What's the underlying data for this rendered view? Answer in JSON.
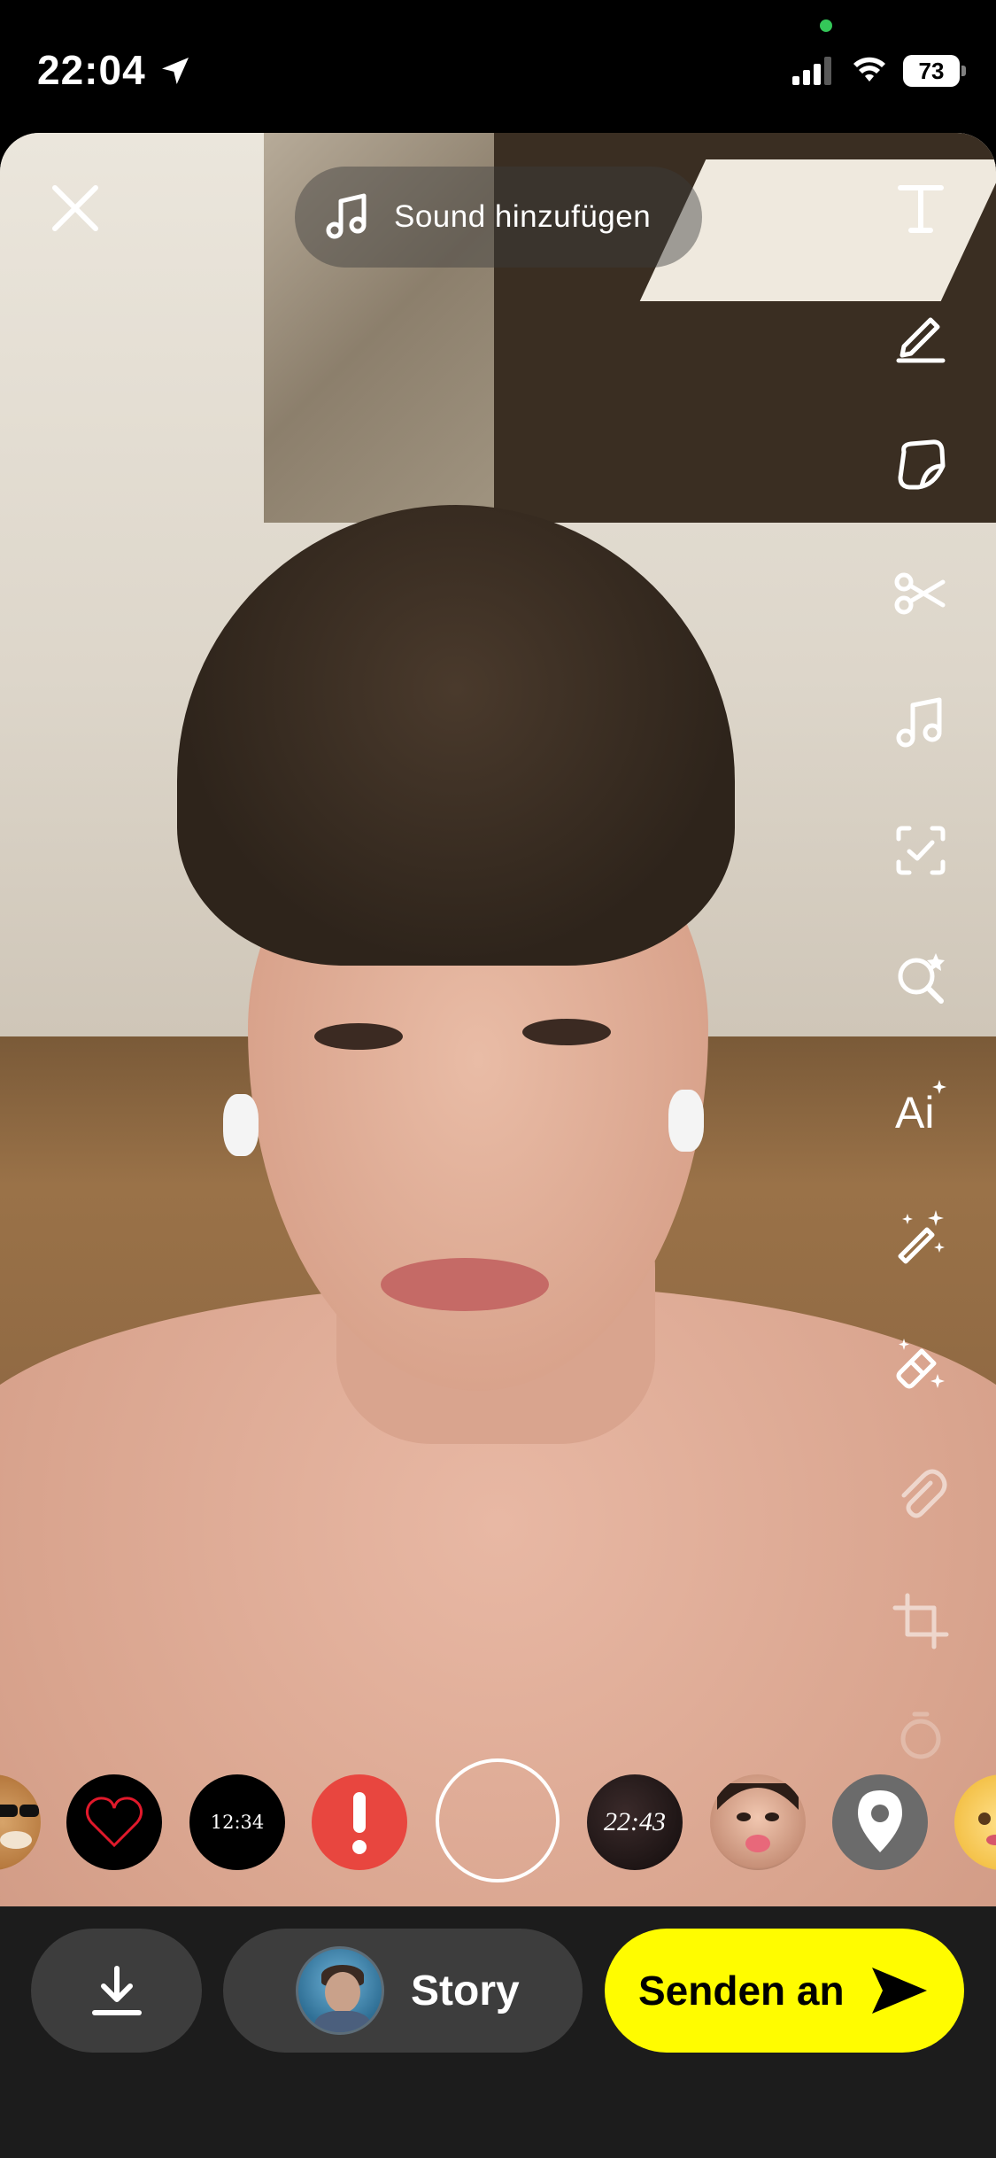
{
  "status_bar": {
    "time": "22:04",
    "battery": "73",
    "icons": [
      "location-arrow-icon",
      "cellular-signal-icon",
      "wifi-icon",
      "battery-icon"
    ]
  },
  "editor": {
    "close_icon": "close-icon",
    "sound_button": {
      "label": "Sound hinzufügen",
      "icon": "music-note-icon"
    },
    "tools": [
      {
        "name": "text-tool",
        "icon": "text-icon"
      },
      {
        "name": "draw-tool",
        "icon": "pencil-icon"
      },
      {
        "name": "sticker-tool",
        "icon": "sticker-icon"
      },
      {
        "name": "scissors-tool",
        "icon": "scissors-icon"
      },
      {
        "name": "music-tool",
        "icon": "music-note-icon"
      },
      {
        "name": "lens-scan-tool",
        "icon": "scan-icon"
      },
      {
        "name": "search-lens-tool",
        "icon": "search-star-icon"
      },
      {
        "name": "ai-tool",
        "icon": "ai-icon",
        "glyph": "Ai"
      },
      {
        "name": "magic-wand-tool",
        "icon": "magic-wand-icon"
      },
      {
        "name": "eraser-tool",
        "icon": "magic-eraser-icon"
      },
      {
        "name": "attachment-tool",
        "icon": "paperclip-icon"
      },
      {
        "name": "crop-tool",
        "icon": "crop-icon"
      },
      {
        "name": "timer-tool",
        "icon": "timer-icon"
      }
    ]
  },
  "sticker_carousel": {
    "items": [
      {
        "name": "sticker-dog-sunglasses",
        "kind": "image"
      },
      {
        "name": "sticker-heart",
        "kind": "icon",
        "icon": "heart-outline-icon"
      },
      {
        "name": "sticker-clock-1",
        "kind": "text",
        "text": "12:34"
      },
      {
        "name": "sticker-exclamation",
        "kind": "icon",
        "icon": "exclamation-icon"
      },
      {
        "name": "sticker-clock-2",
        "kind": "text",
        "text": "22:43"
      },
      {
        "name": "sticker-face",
        "kind": "image"
      },
      {
        "name": "sticker-location",
        "kind": "icon",
        "icon": "location-pin-icon"
      },
      {
        "name": "sticker-emoji",
        "kind": "image"
      }
    ]
  },
  "bottom_bar": {
    "save_icon": "download-icon",
    "story_label": "Story",
    "send_label": "Senden an",
    "send_icon": "send-arrow-icon"
  },
  "colors": {
    "send_button": "#fffc00",
    "bottom_bar": "#1c1c1c",
    "pill": "#3d3d3d",
    "exclamation_sticker": "#e8463f",
    "privacy_dot": "#34c759"
  }
}
